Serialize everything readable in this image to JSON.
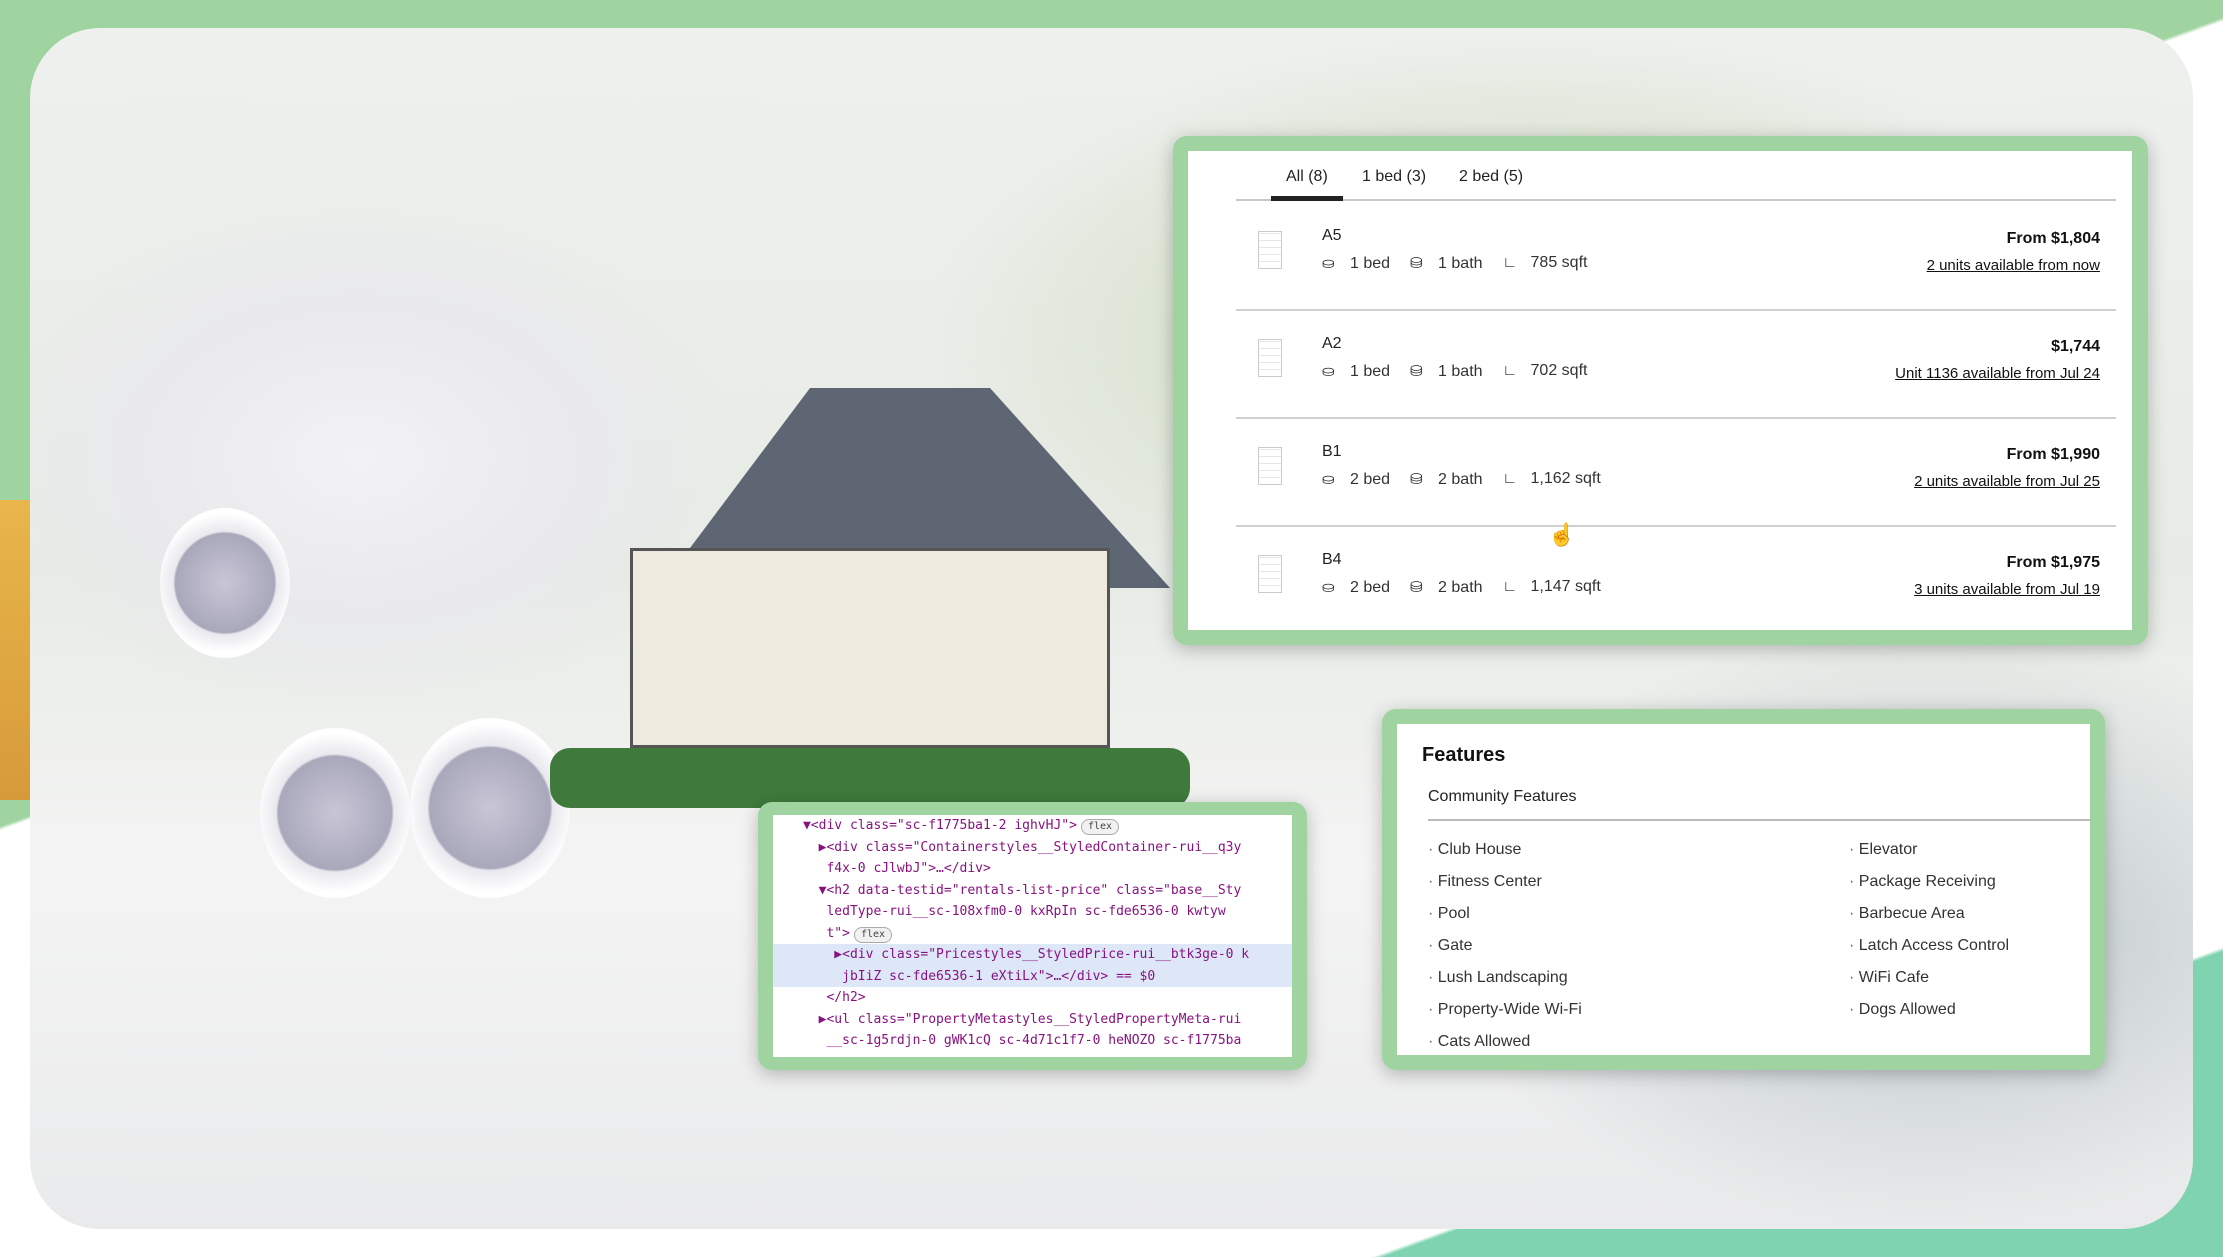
{
  "listing": {
    "tabs": [
      {
        "label": "All (8)",
        "active": true
      },
      {
        "label": "1 bed (3)",
        "active": false
      },
      {
        "label": "2 bed (5)",
        "active": false
      }
    ],
    "icons": {
      "bed": "bed-icon",
      "bath": "bathtub-icon",
      "sqft": "ruler-icon"
    },
    "rows": [
      {
        "name": "A5",
        "beds": "1 bed",
        "baths": "1 bath",
        "sqft": "785 sqft",
        "price": "From $1,804",
        "availability": "2 units available from now"
      },
      {
        "name": "A2",
        "beds": "1 bed",
        "baths": "1 bath",
        "sqft": "702 sqft",
        "price": "$1,744",
        "availability": "Unit 1136 available from Jul 24"
      },
      {
        "name": "B1",
        "beds": "2 bed",
        "baths": "2 bath",
        "sqft": "1,162 sqft",
        "price": "From $1,990",
        "availability": "2 units available from Jul 25"
      },
      {
        "name": "B4",
        "beds": "2 bed",
        "baths": "2 bath",
        "sqft": "1,147 sqft",
        "price": "From $1,975",
        "availability": "3 units available from Jul 19"
      }
    ]
  },
  "devtools": {
    "lines": [
      "▼<div class=\"sc-f1775ba1-2 ighvHJ\">",
      "  ▶<div class=\"Containerstyles__StyledContainer-rui__q3y",
      "   f4x-0 cJlwbJ\">…</div>",
      "  ▼<h2 data-testid=\"rentals-list-price\" class=\"base__Sty",
      "   ledType-rui__sc-108xfm0-0 kxRpIn sc-fde6536-0 kwtyw",
      "   t\">",
      "    ▶<div class=\"Pricestyles__StyledPrice-rui__btk3ge-0 k",
      "     jbIiZ sc-fde6536-1 eXtiLx\">…</div> == $0",
      "   </h2>",
      "  ▶<ul class=\"PropertyMetastyles__StyledPropertyMeta-rui",
      "   __sc-1g5rdjn-0 gWK1cQ sc-4d71c1f7-0 heNOZO sc-f1775ba"
    ],
    "badge": "flex",
    "selected_line": 6
  },
  "features": {
    "title": "Features",
    "subtitle": "Community Features",
    "left": [
      "Club House",
      "Fitness Center",
      "Pool",
      "Gate",
      "Lush Landscaping",
      "Property-Wide Wi-Fi",
      "Cats Allowed"
    ],
    "right": [
      "Elevator",
      "Package Receiving",
      "Barbecue Area",
      "Latch Access Control",
      "WiFi Cafe",
      "Dogs Allowed"
    ]
  },
  "colors": {
    "frame_green": "#9fd4a1",
    "text": "#111111",
    "highlight": "#dde7f8"
  }
}
